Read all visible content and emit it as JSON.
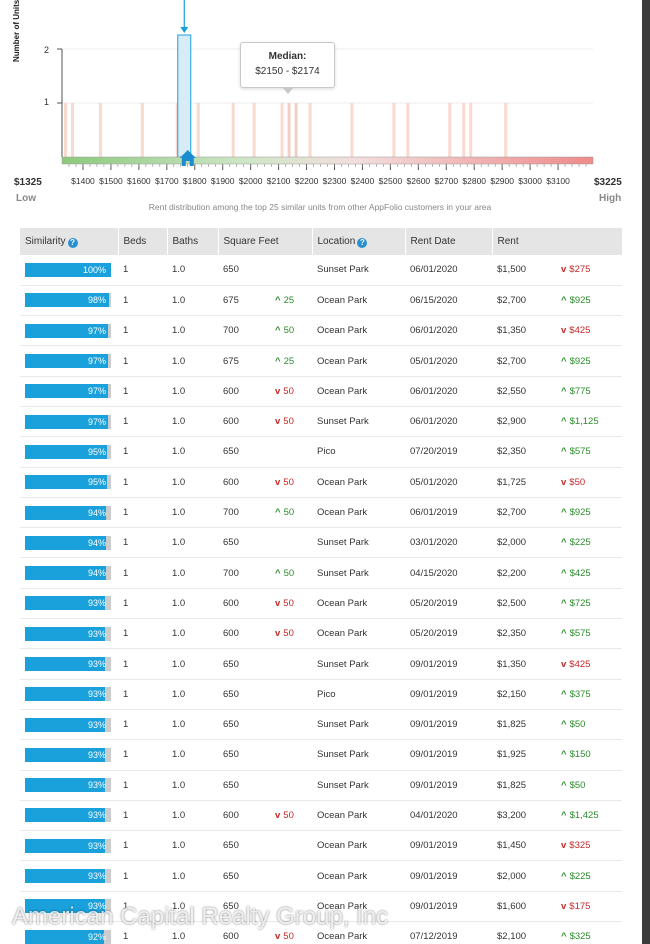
{
  "chart_data": {
    "type": "bar",
    "ylabel": "Number of Units",
    "y_ticks": [
      "2",
      "1"
    ],
    "ylim": [
      0,
      2
    ],
    "x_ticks": [
      "$1400",
      "$1500",
      "$1600",
      "$1700",
      "$1800",
      "$1900",
      "$2000",
      "$2100",
      "$2200",
      "$2300",
      "$2400",
      "$2500",
      "$2600",
      "$2700",
      "$2800",
      "$2900",
      "$3000",
      "$3100"
    ],
    "xlim": [
      1325,
      3225
    ],
    "x_range_low_label": "$1325",
    "x_range_high_label": "$3225",
    "low_label": "Low",
    "high_label": "High",
    "highlighted_bin": "$1750 - $1774",
    "highlighted_bin_start": 1750,
    "current_unit_rent": 1775,
    "median_label": "Median:",
    "median_value": "$2150 - $2174",
    "median_bin_start": 2150,
    "bin_width": 25,
    "bins": [
      {
        "start": 1325,
        "count": 1
      },
      {
        "start": 1350,
        "count": 1
      },
      {
        "start": 1450,
        "count": 1
      },
      {
        "start": 1600,
        "count": 1
      },
      {
        "start": 1725,
        "count": 1
      },
      {
        "start": 1750,
        "count": 2
      },
      {
        "start": 1800,
        "count": 1
      },
      {
        "start": 1925,
        "count": 1
      },
      {
        "start": 2000,
        "count": 1
      },
      {
        "start": 2100,
        "count": 1
      },
      {
        "start": 2125,
        "count": 1
      },
      {
        "start": 2150,
        "count": 1
      },
      {
        "start": 2200,
        "count": 1
      },
      {
        "start": 2350,
        "count": 1
      },
      {
        "start": 2500,
        "count": 1
      },
      {
        "start": 2550,
        "count": 1
      },
      {
        "start": 2700,
        "count": 1
      },
      {
        "start": 2750,
        "count": 1
      },
      {
        "start": 2775,
        "count": 1
      },
      {
        "start": 2900,
        "count": 1
      }
    ],
    "caption": "Rent distribution among the top 25 similar units from other AppFolio customers in your area",
    "colors": {
      "bar": "#f9d3c7",
      "bar_median": "#ecc7bd",
      "highlight": "#d8ecf7",
      "highlight_border": "#1aa0db",
      "axis_green": "#8cc97d",
      "axis_red": "#ef8a8a",
      "home": "#1a8ccf"
    }
  },
  "table": {
    "headers": {
      "similarity": "Similarity",
      "beds": "Beds",
      "baths": "Baths",
      "sqft": "Square Feet",
      "location": "Location",
      "rent_date": "Rent Date",
      "rent": "Rent"
    },
    "info_glyph": "?",
    "rows": [
      {
        "sim": "100%",
        "sim_value": 100,
        "beds": "1",
        "baths": "1.0",
        "sqft": "650",
        "sqft_delta": "",
        "sqft_dir": "",
        "location": "Sunset Park",
        "date": "06/01/2020",
        "rent": "$1,500",
        "rent_delta": "$275",
        "rent_dir": "down"
      },
      {
        "sim": "98%",
        "sim_value": 98,
        "beds": "1",
        "baths": "1.0",
        "sqft": "675",
        "sqft_delta": "25",
        "sqft_dir": "up",
        "location": "Ocean Park",
        "date": "06/15/2020",
        "rent": "$2,700",
        "rent_delta": "$925",
        "rent_dir": "up"
      },
      {
        "sim": "97%",
        "sim_value": 97,
        "beds": "1",
        "baths": "1.0",
        "sqft": "700",
        "sqft_delta": "50",
        "sqft_dir": "up",
        "location": "Ocean Park",
        "date": "06/01/2020",
        "rent": "$1,350",
        "rent_delta": "$425",
        "rent_dir": "down"
      },
      {
        "sim": "97%",
        "sim_value": 97,
        "beds": "1",
        "baths": "1.0",
        "sqft": "675",
        "sqft_delta": "25",
        "sqft_dir": "up",
        "location": "Ocean Park",
        "date": "05/01/2020",
        "rent": "$2,700",
        "rent_delta": "$925",
        "rent_dir": "up"
      },
      {
        "sim": "97%",
        "sim_value": 97,
        "beds": "1",
        "baths": "1.0",
        "sqft": "600",
        "sqft_delta": "50",
        "sqft_dir": "down",
        "location": "Ocean Park",
        "date": "06/01/2020",
        "rent": "$2,550",
        "rent_delta": "$775",
        "rent_dir": "up"
      },
      {
        "sim": "97%",
        "sim_value": 97,
        "beds": "1",
        "baths": "1.0",
        "sqft": "600",
        "sqft_delta": "50",
        "sqft_dir": "down",
        "location": "Sunset Park",
        "date": "06/01/2020",
        "rent": "$2,900",
        "rent_delta": "$1,125",
        "rent_dir": "up"
      },
      {
        "sim": "95%",
        "sim_value": 95,
        "beds": "1",
        "baths": "1.0",
        "sqft": "650",
        "sqft_delta": "",
        "sqft_dir": "",
        "location": "Pico",
        "date": "07/20/2019",
        "rent": "$2,350",
        "rent_delta": "$575",
        "rent_dir": "up"
      },
      {
        "sim": "95%",
        "sim_value": 95,
        "beds": "1",
        "baths": "1.0",
        "sqft": "600",
        "sqft_delta": "50",
        "sqft_dir": "down",
        "location": "Ocean Park",
        "date": "05/01/2020",
        "rent": "$1,725",
        "rent_delta": "$50",
        "rent_dir": "down"
      },
      {
        "sim": "94%",
        "sim_value": 94,
        "beds": "1",
        "baths": "1.0",
        "sqft": "700",
        "sqft_delta": "50",
        "sqft_dir": "up",
        "location": "Ocean Park",
        "date": "06/01/2019",
        "rent": "$2,700",
        "rent_delta": "$925",
        "rent_dir": "up"
      },
      {
        "sim": "94%",
        "sim_value": 94,
        "beds": "1",
        "baths": "1.0",
        "sqft": "650",
        "sqft_delta": "",
        "sqft_dir": "",
        "location": "Sunset Park",
        "date": "03/01/2020",
        "rent": "$2,000",
        "rent_delta": "$225",
        "rent_dir": "up"
      },
      {
        "sim": "94%",
        "sim_value": 94,
        "beds": "1",
        "baths": "1.0",
        "sqft": "700",
        "sqft_delta": "50",
        "sqft_dir": "up",
        "location": "Sunset Park",
        "date": "04/15/2020",
        "rent": "$2,200",
        "rent_delta": "$425",
        "rent_dir": "up"
      },
      {
        "sim": "93%",
        "sim_value": 93,
        "beds": "1",
        "baths": "1.0",
        "sqft": "600",
        "sqft_delta": "50",
        "sqft_dir": "down",
        "location": "Ocean Park",
        "date": "05/20/2019",
        "rent": "$2,500",
        "rent_delta": "$725",
        "rent_dir": "up"
      },
      {
        "sim": "93%",
        "sim_value": 93,
        "beds": "1",
        "baths": "1.0",
        "sqft": "600",
        "sqft_delta": "50",
        "sqft_dir": "down",
        "location": "Ocean Park",
        "date": "05/20/2019",
        "rent": "$2,350",
        "rent_delta": "$575",
        "rent_dir": "up"
      },
      {
        "sim": "93%",
        "sim_value": 93,
        "beds": "1",
        "baths": "1.0",
        "sqft": "650",
        "sqft_delta": "",
        "sqft_dir": "",
        "location": "Sunset Park",
        "date": "09/01/2019",
        "rent": "$1,350",
        "rent_delta": "$425",
        "rent_dir": "down"
      },
      {
        "sim": "93%",
        "sim_value": 93,
        "beds": "1",
        "baths": "1.0",
        "sqft": "650",
        "sqft_delta": "",
        "sqft_dir": "",
        "location": "Pico",
        "date": "09/01/2019",
        "rent": "$2,150",
        "rent_delta": "$375",
        "rent_dir": "up"
      },
      {
        "sim": "93%",
        "sim_value": 93,
        "beds": "1",
        "baths": "1.0",
        "sqft": "650",
        "sqft_delta": "",
        "sqft_dir": "",
        "location": "Sunset Park",
        "date": "09/01/2019",
        "rent": "$1,825",
        "rent_delta": "$50",
        "rent_dir": "up"
      },
      {
        "sim": "93%",
        "sim_value": 93,
        "beds": "1",
        "baths": "1.0",
        "sqft": "650",
        "sqft_delta": "",
        "sqft_dir": "",
        "location": "Sunset Park",
        "date": "09/01/2019",
        "rent": "$1,925",
        "rent_delta": "$150",
        "rent_dir": "up"
      },
      {
        "sim": "93%",
        "sim_value": 93,
        "beds": "1",
        "baths": "1.0",
        "sqft": "650",
        "sqft_delta": "",
        "sqft_dir": "",
        "location": "Sunset Park",
        "date": "09/01/2019",
        "rent": "$1,825",
        "rent_delta": "$50",
        "rent_dir": "up"
      },
      {
        "sim": "93%",
        "sim_value": 93,
        "beds": "1",
        "baths": "1.0",
        "sqft": "600",
        "sqft_delta": "50",
        "sqft_dir": "down",
        "location": "Ocean Park",
        "date": "04/01/2020",
        "rent": "$3,200",
        "rent_delta": "$1,425",
        "rent_dir": "up"
      },
      {
        "sim": "93%",
        "sim_value": 93,
        "beds": "1",
        "baths": "1.0",
        "sqft": "650",
        "sqft_delta": "",
        "sqft_dir": "",
        "location": "Ocean Park",
        "date": "09/01/2019",
        "rent": "$1,450",
        "rent_delta": "$325",
        "rent_dir": "down"
      },
      {
        "sim": "93%",
        "sim_value": 93,
        "beds": "1",
        "baths": "1.0",
        "sqft": "650",
        "sqft_delta": "",
        "sqft_dir": "",
        "location": "Ocean Park",
        "date": "09/01/2019",
        "rent": "$2,000",
        "rent_delta": "$225",
        "rent_dir": "up"
      },
      {
        "sim": "93%",
        "sim_value": 93,
        "beds": "1",
        "baths": "1.0",
        "sqft": "650",
        "sqft_delta": "",
        "sqft_dir": "",
        "location": "Ocean Park",
        "date": "09/01/2019",
        "rent": "$1,600",
        "rent_delta": "$175",
        "rent_dir": "down"
      },
      {
        "sim": "92%",
        "sim_value": 92,
        "beds": "1",
        "baths": "1.0",
        "sqft": "600",
        "sqft_delta": "50",
        "sqft_dir": "down",
        "location": "Ocean Park",
        "date": "07/12/2019",
        "rent": "$2,100",
        "rent_delta": "$325",
        "rent_dir": "up"
      }
    ]
  },
  "icons": {
    "arrow_up": "^",
    "arrow_down": "v"
  },
  "watermark": "American Capital Realty Group, Inc"
}
